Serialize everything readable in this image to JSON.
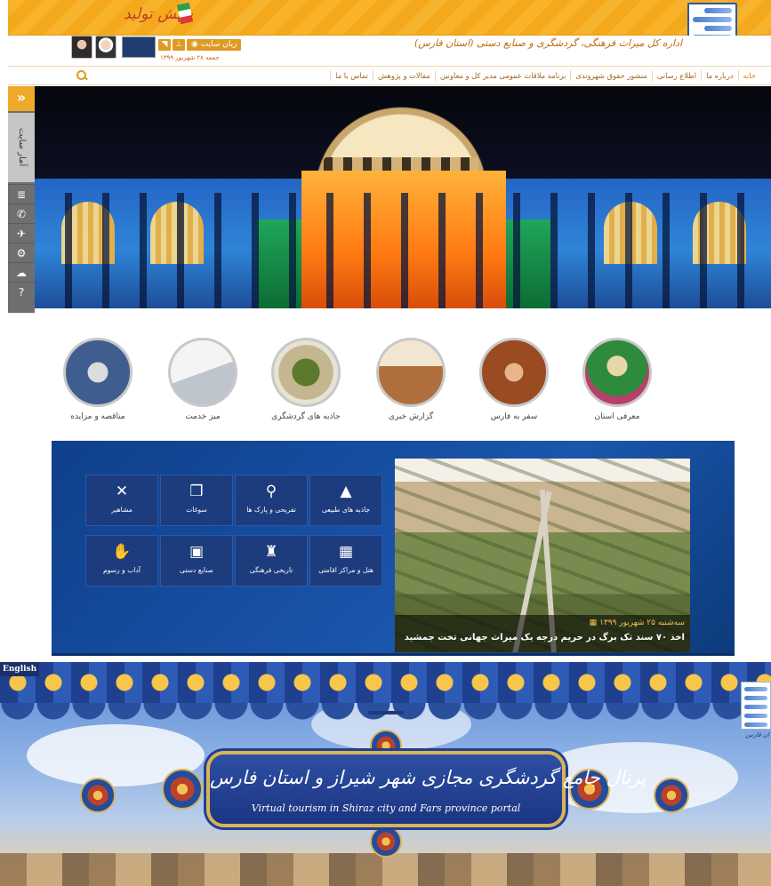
{
  "site": {
    "jahesh_text": "جهش تولید",
    "org_title": "اداره کل میراث فرهنگی، گردشگری و صنایع دستی (استان فارس)",
    "lang_button": "زبان سایت",
    "date": "جمعه ۲۸ شهریور ۱۳۹۹",
    "nav": [
      "خانه",
      "درباره ما",
      "اطلاع رسانی",
      "منشور حقوق شهروندی",
      "برنامه ملاقات عمومی مدیر کل و معاونین",
      "مقالات و پژوهش",
      "تماس با ما"
    ],
    "sidebar": {
      "stats_label": "آمار سایت",
      "icons": [
        "database-icon",
        "phone-icon",
        "plane-icon",
        "gears-icon",
        "chat-icon",
        "help-icon"
      ]
    },
    "circles": [
      "معرفی استان",
      "سفر به فارس",
      "گزارش خبری",
      "جاذبه های گردشگری",
      "میز خدمت",
      "مناقصه و مزایده"
    ],
    "tiles": [
      {
        "label": "جاذبه های طبیعی",
        "icon": "▲"
      },
      {
        "label": "تفریحی و پارک ها",
        "icon": "⚲"
      },
      {
        "label": "سوغات",
        "icon": "❒"
      },
      {
        "label": "مشاهیر",
        "icon": "✕"
      },
      {
        "label": "هتل و مراکز اقامتی",
        "icon": "▦"
      },
      {
        "label": "تاریخی فرهنگی",
        "icon": "♜"
      },
      {
        "label": "صنایع دستی",
        "icon": "▣"
      },
      {
        "label": "آداب و رسوم",
        "icon": "✋"
      }
    ],
    "feature": {
      "date": "سه‌شنبه ۲۵ شهریور ۱۳۹۹",
      "title": "اخذ ۷۰ سند تک برگ در حریم درجه یک میراث جهانی تخت جمشید"
    }
  },
  "portal": {
    "lang_label": "English",
    "logo_text": "ان فارس",
    "title_fa": "پرتال جامع گردشگری مجازی شهر شیراز و استان فارس",
    "title_en": "Virtual tourism in Shiraz city and Fars province portal"
  },
  "colors": {
    "accent_orange": "#f4a91c",
    "nav_text": "#a3661c",
    "blue_section": "#1a56ad",
    "tile_blue": "#1d3c7e"
  }
}
